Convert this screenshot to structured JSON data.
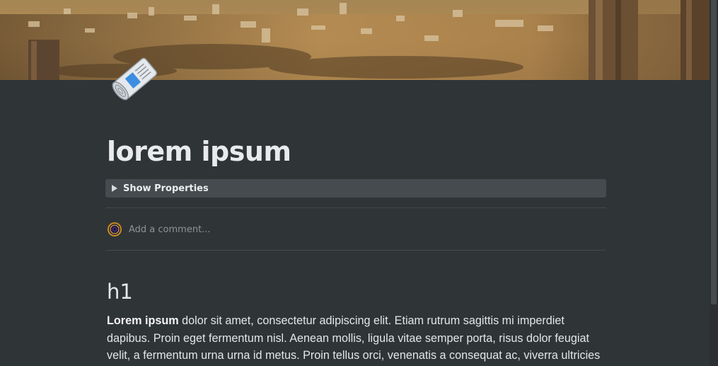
{
  "cover": {
    "icon": "ancient-ruins-photo"
  },
  "page_icon": {
    "icon": "rolled-newspaper-icon"
  },
  "page": {
    "title": "lorem ipsum"
  },
  "properties": {
    "toggle_label": "Show Properties",
    "toggle_icon": "triangle-right-icon"
  },
  "comment": {
    "placeholder": "Add a comment...",
    "avatar_icon": "user-avatar-icon"
  },
  "content": {
    "heading": "h1",
    "paragraph_bold": "Lorem ipsum",
    "paragraph_rest": " dolor sit amet, consectetur adipiscing elit. Etiam rutrum sagittis mi imperdiet dapibus. Proin eget fermentum nisl. Aenean mollis, ligula vitae semper porta, risus dolor feugiat velit, a fermentum urna urna id metus. Proin tellus orci, venenatis a consequat ac, viverra ultricies ligula."
  },
  "colors": {
    "background": "#2f3437",
    "properties_bg": "#454b4e",
    "text": "#e9eaeb",
    "muted_text": "#8e9396"
  }
}
